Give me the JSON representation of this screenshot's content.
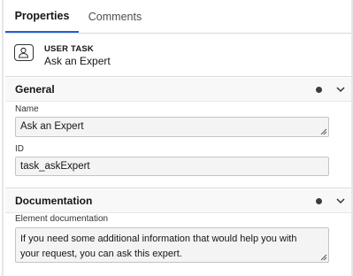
{
  "tabs": [
    {
      "label": "Properties",
      "active": true
    },
    {
      "label": "Comments",
      "active": false
    }
  ],
  "element": {
    "type": "USER TASK",
    "name": "Ask an Expert",
    "icon": "user-task-icon"
  },
  "groups": {
    "general": {
      "title": "General",
      "name_label": "Name",
      "name_value": "Ask an Expert",
      "id_label": "ID",
      "id_value": "task_askExpert"
    },
    "documentation": {
      "title": "Documentation",
      "doc_label": "Element documentation",
      "doc_line1": "If you need some additional information that would help you with",
      "doc_line2": "your request, you can ask this expert."
    }
  },
  "colors": {
    "accent": "#1f5fd6",
    "group_bg": "#f8f8f8",
    "field_bg": "#f4f4f4"
  }
}
